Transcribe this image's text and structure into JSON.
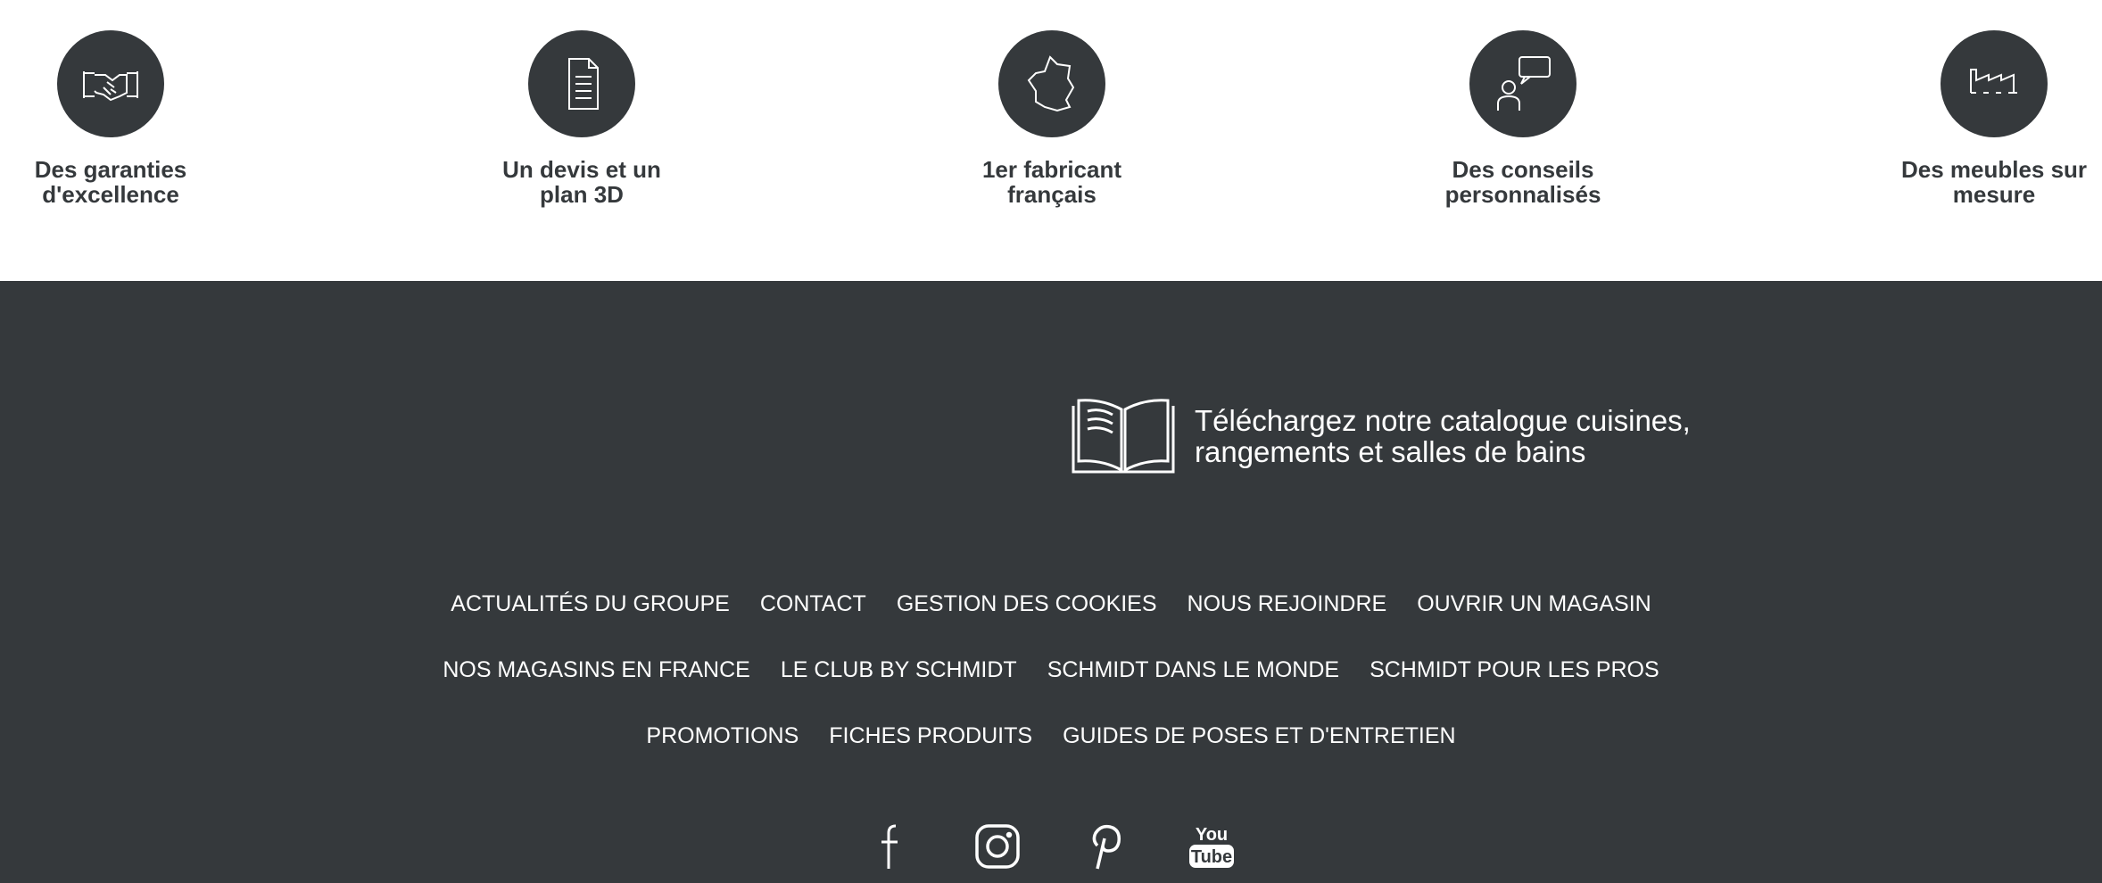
{
  "features": [
    {
      "icon": "handshake-icon",
      "label": "Des garanties\nd'excellence"
    },
    {
      "icon": "document-icon",
      "label": "Un devis et un\nplan 3D"
    },
    {
      "icon": "france-map-icon",
      "label": "1er fabricant\nfrançais"
    },
    {
      "icon": "advisor-chat-icon",
      "label": "Des conseils\npersonnalisés"
    },
    {
      "icon": "factory-icon",
      "label": "Des meubles sur\nmesure"
    }
  ],
  "footer": {
    "catalog": {
      "icon": "open-book-icon",
      "text": "Téléchargez notre catalogue cuisines,\nrangements et salles de bains"
    },
    "links_row1": [
      "ACTUALITÉS DU GROUPE",
      "CONTACT",
      "GESTION DES COOKIES",
      "NOUS REJOINDRE",
      "OUVRIR UN MAGASIN"
    ],
    "links_row2": [
      "NOS MAGASINS EN FRANCE",
      "LE CLUB BY SCHMIDT",
      "SCHMIDT DANS LE MONDE",
      "SCHMIDT POUR LES PROS"
    ],
    "links_row3": [
      "PROMOTIONS",
      "FICHES PRODUITS",
      "GUIDES DE POSES ET D'ENTRETIEN"
    ],
    "social": [
      "facebook-icon",
      "instagram-icon",
      "pinterest-icon",
      "youtube-icon"
    ],
    "youtube_logo": {
      "top": "You",
      "bottom": "Tube"
    }
  },
  "colors": {
    "dark": "#35393c",
    "white": "#ffffff"
  }
}
